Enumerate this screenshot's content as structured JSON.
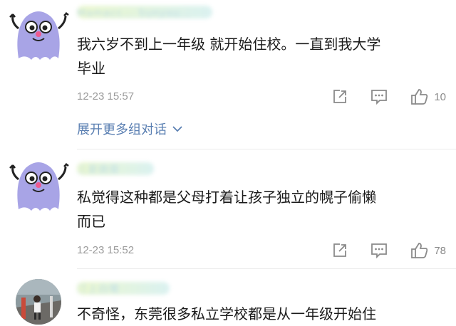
{
  "comments": [
    {
      "username": "Mamacc... Sunyou...",
      "text_line1": "我六岁不到上一年级 就开始住校。一直到我大学",
      "text_line2": "毕业",
      "timestamp": "12-23 15:57",
      "likes": "10",
      "expand_label": "展开更多组对话",
      "avatar_icon": "ghost-avatar"
    },
    {
      "username": "三夏蔬菜",
      "text_line1": "私觉得这种都是父母打着让孩子独立的幌子偷懒",
      "text_line2": "而已",
      "timestamp": "12-23 15:52",
      "likes": "78",
      "avatar_icon": "ghost-avatar"
    },
    {
      "username": "汀上白鹭",
      "text_line1": "不奇怪，东莞很多私立学校都是从一年级开始住",
      "avatar_icon": "photo-avatar"
    }
  ],
  "icons": {
    "share": "share-icon",
    "reply": "comment-icon",
    "like": "thumbs-up-icon",
    "expand": "chevron-down-icon"
  },
  "colors": {
    "link": "#5a7fb2",
    "meta": "#9a9a9a",
    "ghost": "#a8a4e6"
  }
}
